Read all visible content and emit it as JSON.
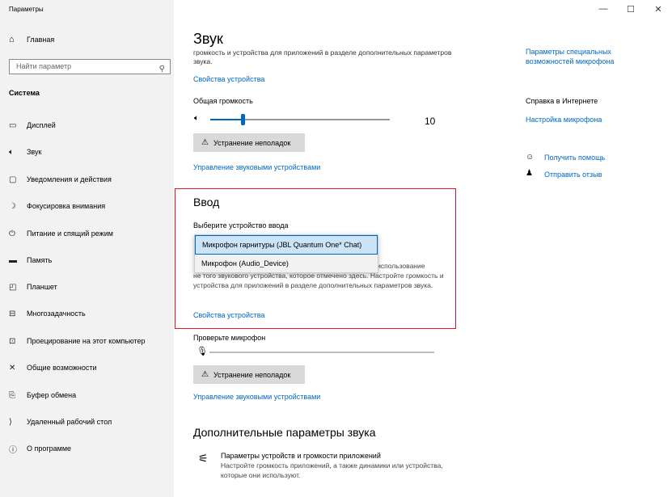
{
  "window": {
    "title": "Параметры",
    "controls": [
      "—",
      "☐",
      "✕"
    ]
  },
  "sidebar": {
    "home_label": "Главная",
    "search_placeholder": "Найти параметр",
    "section_header": "Система",
    "items": [
      {
        "label": "Дисплей",
        "icon": "display-icon"
      },
      {
        "label": "Звук",
        "icon": "speaker-icon"
      },
      {
        "label": "Уведомления и действия",
        "icon": "notifications-icon"
      },
      {
        "label": "Фокусировка внимания",
        "icon": "moon-icon"
      },
      {
        "label": "Питание и спящий режим",
        "icon": "power-icon"
      },
      {
        "label": "Память",
        "icon": "storage-icon"
      },
      {
        "label": "Планшет",
        "icon": "tablet-icon"
      },
      {
        "label": "Многозадачность",
        "icon": "multitasking-icon"
      },
      {
        "label": "Проецирование на этот компьютер",
        "icon": "projection-icon"
      },
      {
        "label": "Общие возможности",
        "icon": "shared-icon"
      },
      {
        "label": "Буфер обмена",
        "icon": "clipboard-icon"
      },
      {
        "label": "Удаленный рабочий стол",
        "icon": "remote-desktop-icon"
      },
      {
        "label": "О программе",
        "icon": "info-icon"
      }
    ]
  },
  "main": {
    "title": "Звук",
    "output_cut_text": "громкость и устройства для приложений в разделе дополнительных параметров звука.",
    "output_device_props_link": "Свойства устройства",
    "volume_label": "Общая громкость",
    "volume_value": "10",
    "volume_level": 0.18,
    "troubleshoot_label": "Устранение неполадок",
    "manage_devices_link": "Управление звуковыми устройствами",
    "input_heading": "Ввод",
    "input_choose_label": "Выберите устройство ввода",
    "input_options": [
      "Микрофон гарнитуры (JBL Quantum One* Chat)",
      "Микрофон (Audio_Device)"
    ],
    "input_desc_tail": "о использование",
    "input_desc": "не того звукового устройства, которое отмечено здесь. Настройте громкость и устройства для приложений в разделе дополнительных параметров звука.",
    "input_device_props_link": "Свойства устройства",
    "mic_test_label": "Проверьте микрофон",
    "mic_level": 0,
    "troubleshoot_label_2": "Устранение неполадок",
    "manage_devices_link_2": "Управление звуковыми устройствами",
    "advanced_heading": "Дополнительные параметры звука",
    "app_volume_title": "Параметры устройств и громкости приложений",
    "app_volume_desc": "Настройте громкость приложений, а также динамики или устройства, которые они используют."
  },
  "right": {
    "mic_access_link": "Параметры специальных возможностей микрофона",
    "help_heading": "Справка в Интернете",
    "mic_setup_link": "Настройка микрофона",
    "get_help_link": "Получить помощь",
    "feedback_link": "Отправить отзыв"
  },
  "colors": {
    "accent": "#0067c0",
    "highlight_box": "#e81123"
  }
}
